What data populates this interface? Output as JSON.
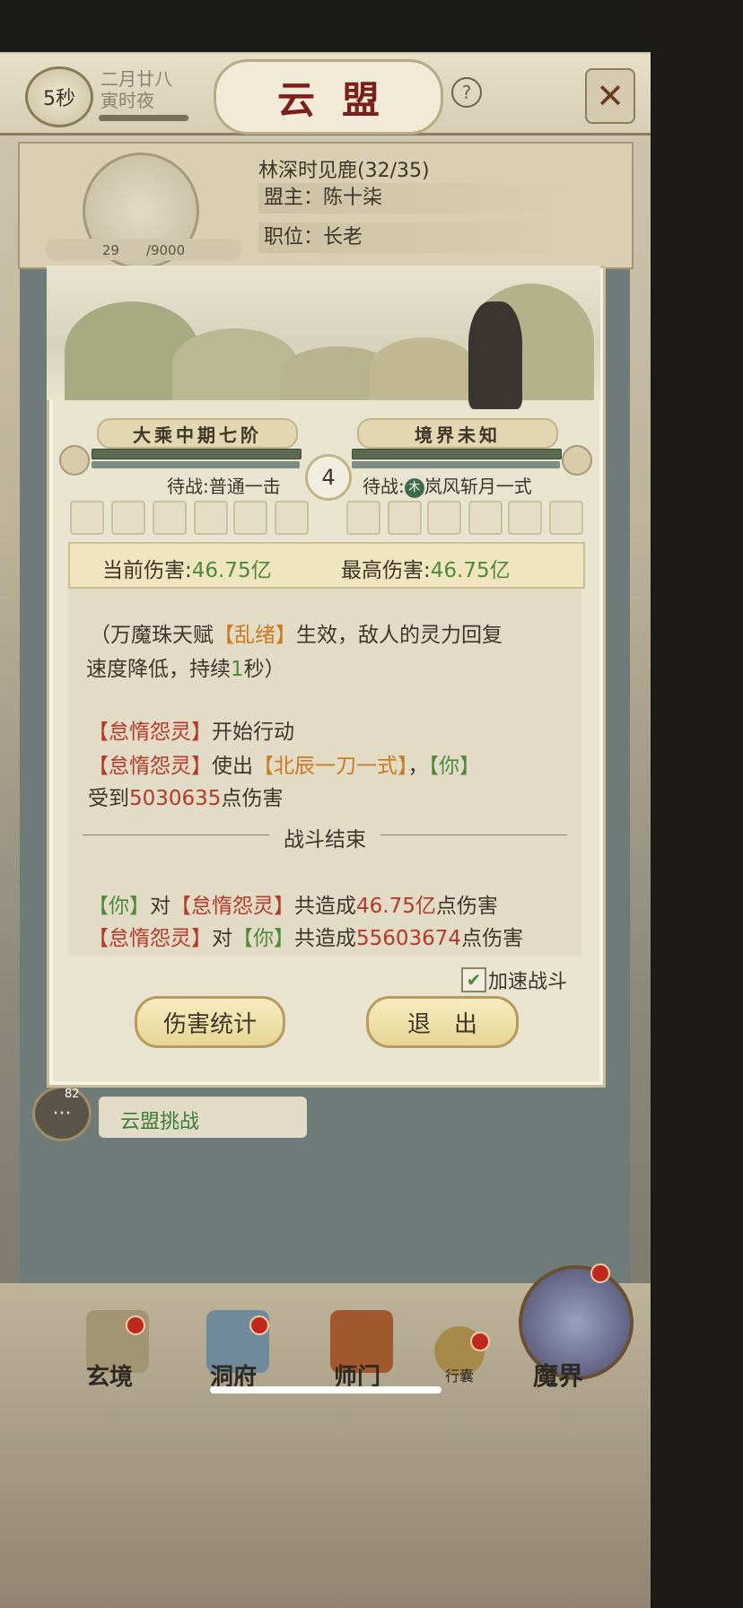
{
  "header": {
    "timer": "5秒",
    "date": "二月廿八",
    "time_of_day": "寅时夜",
    "title": "云盟"
  },
  "guild": {
    "name": "林深时见鹿(32/35)",
    "leader": "盟主：陈十柒",
    "position": "职位：长老",
    "exp": "29　　/9000"
  },
  "battle": {
    "player_realm": "大乘中期七阶",
    "enemy_realm": "境界未知",
    "round": "4",
    "player_wait_prefix": "待战:",
    "player_wait_skill": "普通一击",
    "enemy_wait_prefix": "待战:",
    "enemy_wait_element": "木",
    "enemy_wait_skill": "岚风斩月一式",
    "current_damage_label": "当前伤害:",
    "current_damage_value": "46.75亿",
    "max_damage_label": "最高伤害:",
    "max_damage_value": "46.75亿",
    "log": {
      "l1_a": "（万魔珠天赋",
      "l1_b": "【乱绪】",
      "l1_c": "生效，敌人的灵力回复",
      "l2_a": "速度降低，持续",
      "l2_b": "1",
      "l2_c": "秒）",
      "l3_a": "【怠惰怨灵】",
      "l3_b": "开始行动",
      "l4_a": "【怠惰怨灵】",
      "l4_b": "使出",
      "l4_c": "【北辰一刀一式】",
      "l4_d": "，",
      "l4_e": "【你】",
      "l5_a": "受到",
      "l5_b": "5030635",
      "l5_c": "点伤害",
      "end_label": "战斗结束",
      "l6_a": "【你】",
      "l6_b": "对",
      "l6_c": "【怠惰怨灵】",
      "l6_d": "共造成",
      "l6_e": "46.75亿",
      "l6_f": "点伤害",
      "l7_a": "【怠惰怨灵】",
      "l7_b": "对",
      "l7_c": "【你】",
      "l7_d": "共造成",
      "l7_e": "55603674",
      "l7_f": "点伤害"
    },
    "speedup_label": "加速战斗",
    "stats_button": "伤害统计",
    "exit_button": "退　出"
  },
  "chat": {
    "badge": "82",
    "label": "云盟挑战"
  },
  "nav": {
    "xuanjing": "玄境",
    "dongfu": "洞府",
    "shimen": "师门",
    "xingnang": "行囊",
    "mojie": "魔界"
  },
  "colors": {
    "enemy_name": "#b7392b",
    "skill_name": "#cc7a1c",
    "player_name": "#4d8a3a",
    "damage_value": "#4d9a3a"
  }
}
